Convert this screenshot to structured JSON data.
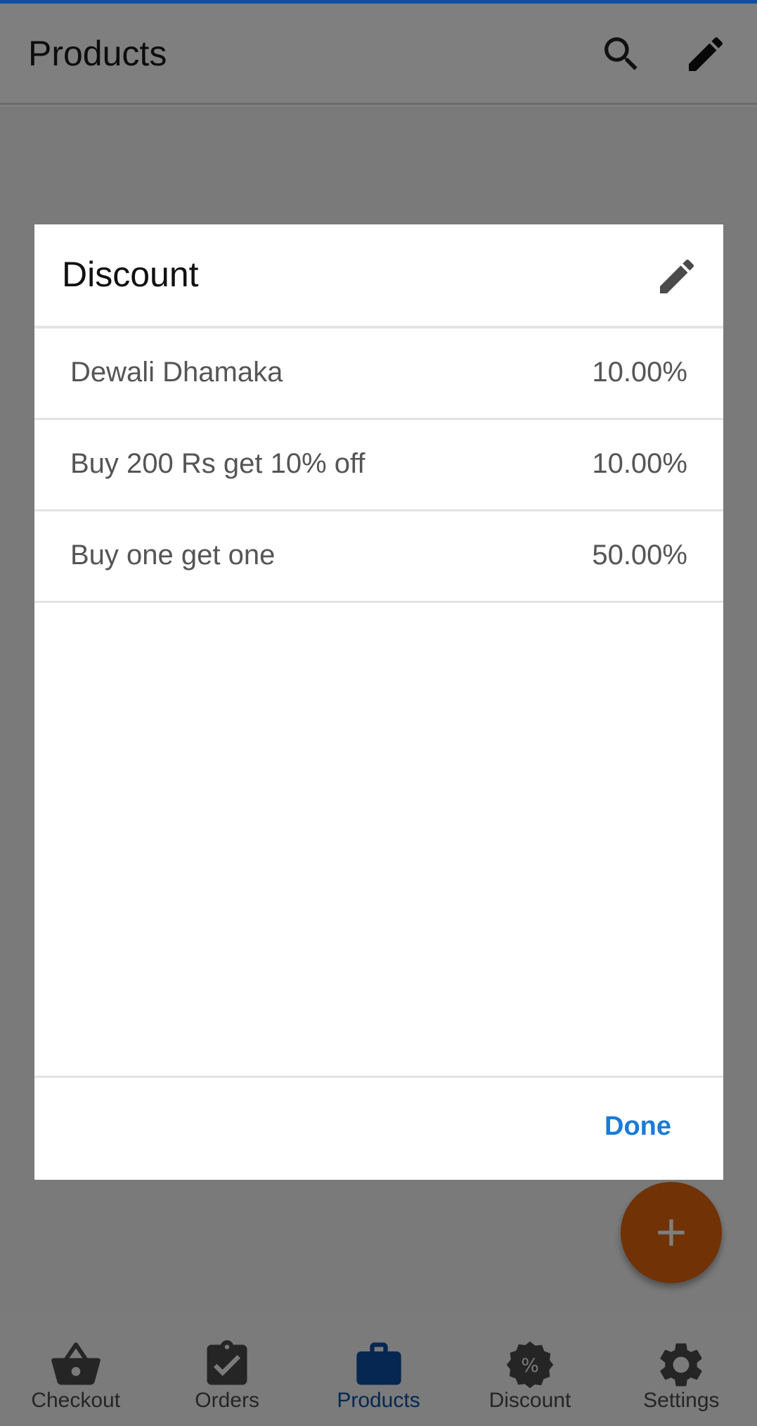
{
  "app_bar": {
    "title": "Products",
    "search_icon": "search-icon",
    "edit_icon": "pencil-icon"
  },
  "fab": {
    "icon": "plus-icon",
    "color": "#e2650d"
  },
  "bottom_nav": {
    "items": [
      {
        "label": "Checkout",
        "icon": "basket-icon",
        "active": false
      },
      {
        "label": "Orders",
        "icon": "clipboard-check-icon",
        "active": false
      },
      {
        "label": "Products",
        "icon": "briefcase-icon",
        "active": true
      },
      {
        "label": "Discount",
        "icon": "discount-badge-icon",
        "active": false
      },
      {
        "label": "Settings",
        "icon": "gear-icon",
        "active": false
      }
    ],
    "active_color": "#0b4ea2"
  },
  "dialog": {
    "title": "Discount",
    "edit_icon": "pencil-icon",
    "discounts": [
      {
        "name": "Dewali Dhamaka",
        "value": "10.00%"
      },
      {
        "name": "Buy 200 Rs get 10% off",
        "value": "10.00%"
      },
      {
        "name": "Buy one get one",
        "value": "50.00%"
      }
    ],
    "done_label": "Done",
    "done_color": "#1a7bd6"
  },
  "colors": {
    "accent": "#0b4ea2",
    "scrim_opacity": 0.5
  }
}
